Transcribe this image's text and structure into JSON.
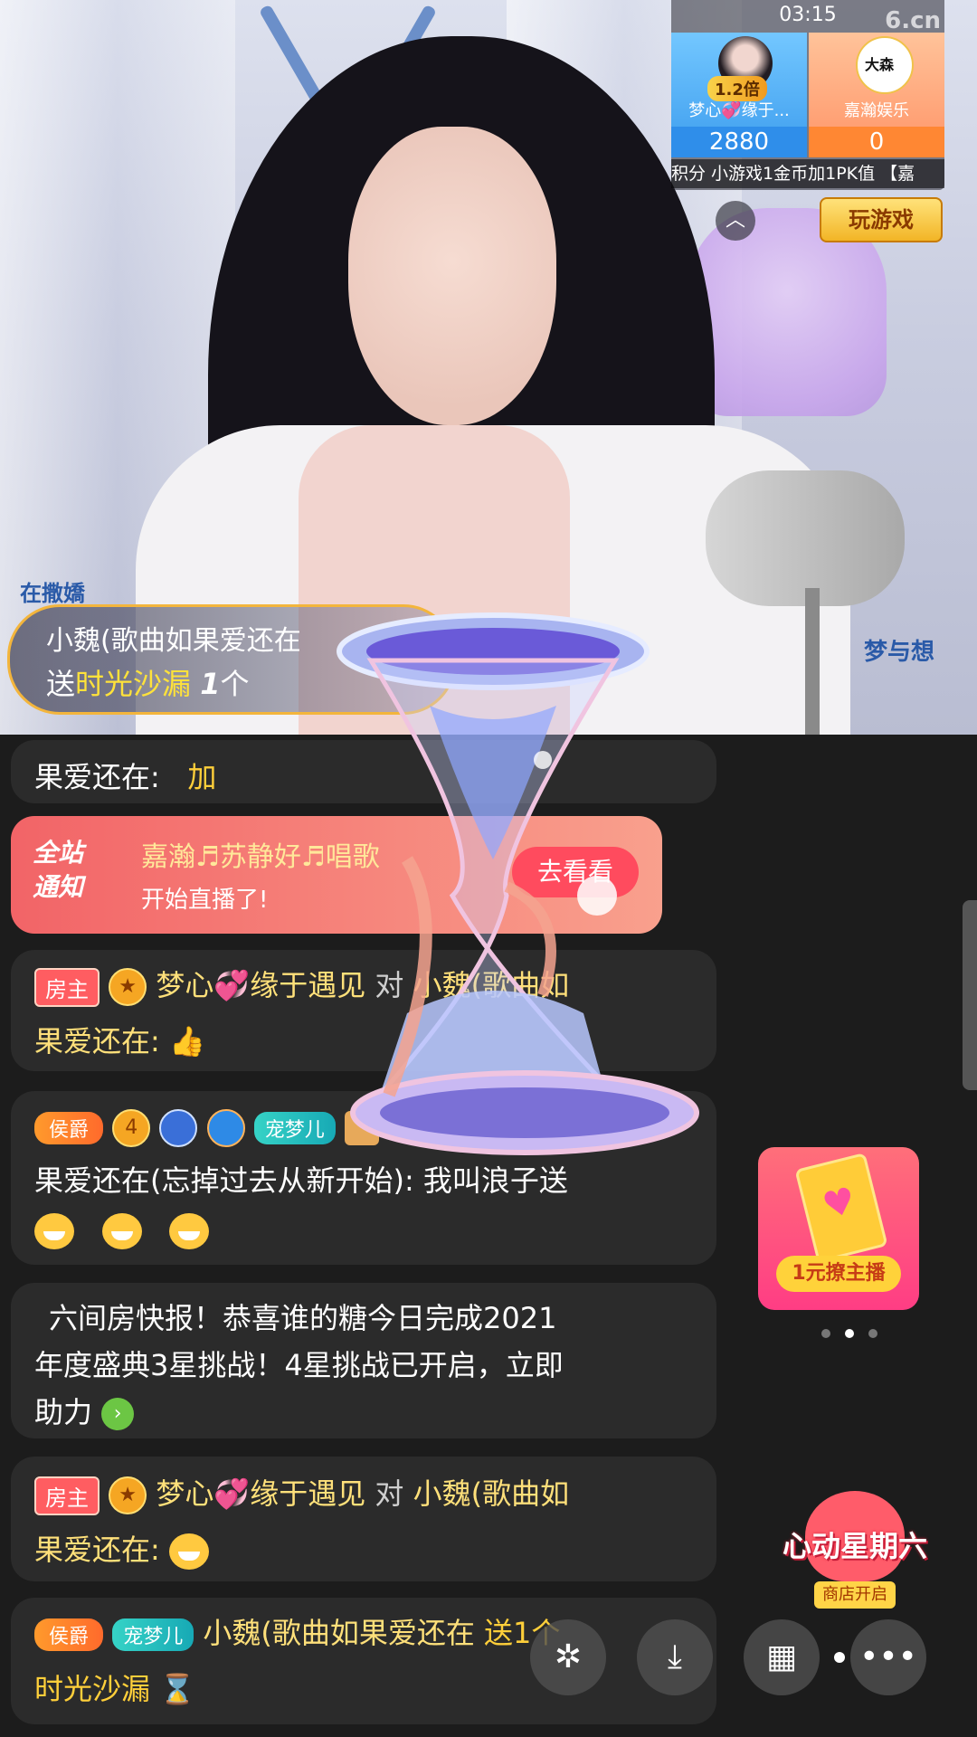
{
  "pk_panel": {
    "timer": "03:15",
    "left": {
      "multiplier": "1.2倍",
      "name": "梦心💞缘于...",
      "score": "2880"
    },
    "right": {
      "name": "嘉瀚娱乐",
      "score": "0"
    },
    "ticker": "积分   小游戏1金币加1PK值   【嘉"
  },
  "play_game_label": "玩游戏",
  "collapse_icon": "chevron-up-icon",
  "host_tag_left": "在撒嬌",
  "host_tag_right": "梦与想",
  "gift_banner": {
    "sender": "小魏(歌曲如果爱还在",
    "send_word": "送",
    "gift": "时光沙漏",
    "count": "1",
    "unit": "个"
  },
  "chat": {
    "partial": {
      "text": "果爱还在:",
      "tail": "加"
    },
    "notice": {
      "tag1": "全站",
      "tag2": "通知",
      "line1": "嘉瀚♬苏静好♬唱歌",
      "line2": "开始直播了!",
      "button": "去看看"
    },
    "msg1": {
      "badge": "房主",
      "level": "★",
      "user": "梦心",
      "user2": "缘于遇见",
      "to": "对",
      "target": "小魏(歌曲如",
      "line2": "果爱还在:"
    },
    "msg2": {
      "badge": "侯爵",
      "level": "4",
      "pet": "宠梦儿",
      "line1_tail": "小魏(歌曲如",
      "line2": "果爱还在(忘掉过去从新开始): 我叫浪子送"
    },
    "msg3": {
      "line1": "六间房快报！恭喜谁的糖今日完成2021",
      "line2": "年度盛典3星挑战！4星挑战已开启，立即",
      "line3": "助力"
    },
    "msg4": {
      "badge": "房主",
      "level": "★",
      "user": "梦心",
      "user2": "缘于遇见",
      "to": "对",
      "target": "小魏(歌曲如",
      "line2": "果爱还在:"
    },
    "msg5": {
      "badge": "侯爵",
      "pet": "宠梦儿",
      "user": "小魏(歌曲如果爱还在",
      "send": "送1个",
      "line2": "时光沙漏"
    }
  },
  "promo_card": {
    "button": "1元撩主播"
  },
  "heartbeat": {
    "title": "心动星期六",
    "sub": "商店开启"
  },
  "bottom_buttons": [
    "share-icon",
    "download-icon",
    "grid-icon",
    "more-icon"
  ]
}
